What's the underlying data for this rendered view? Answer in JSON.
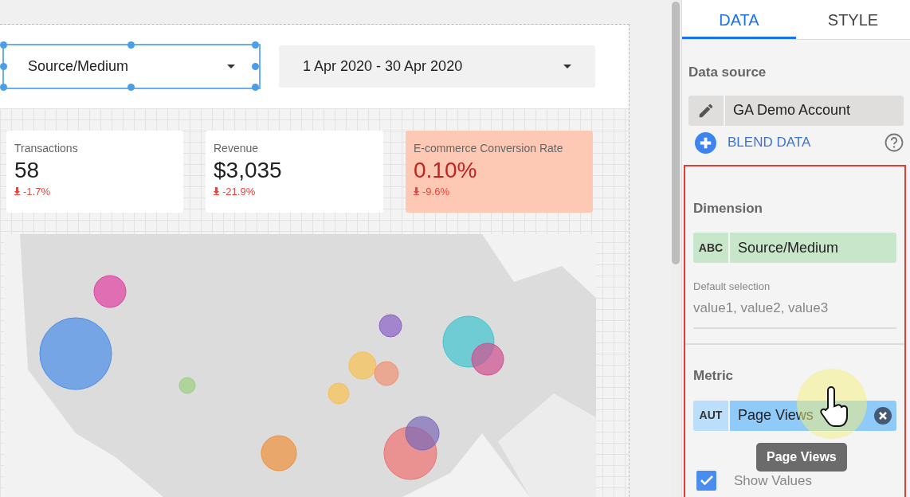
{
  "controls": [
    {
      "kind": "dropdown",
      "label": "Source/Medium",
      "selected": true
    },
    {
      "kind": "dropdown",
      "label": "1 Apr 2020 - 30 Apr 2020",
      "selected": false
    }
  ],
  "scorecards": [
    {
      "label": "Transactions",
      "value": "58",
      "change": "-1.7%",
      "highlighted": false
    },
    {
      "label": "Revenue",
      "value": "$3,035",
      "change": "-21.9%",
      "highlighted": false
    },
    {
      "label": "E-commerce Conversion Rate",
      "value": "0.10%",
      "change": "-9.6%",
      "highlighted": true
    }
  ],
  "panel": {
    "tabs": [
      {
        "label": "DATA",
        "selected": true
      },
      {
        "label": "STYLE",
        "selected": false
      }
    ],
    "data_source": {
      "heading": "Data source",
      "name": "GA Demo Account",
      "blend": "BLEND DATA"
    },
    "dimension": {
      "heading": "Dimension",
      "type": "ABC",
      "field": "Source/Medium",
      "default_label": "Default selection",
      "default_placeholder": "value1, value2, value3"
    },
    "metric": {
      "heading": "Metric",
      "type": "AUT",
      "field": "Page Views"
    },
    "show_values": {
      "label": "Show Values",
      "checked": true
    },
    "tooltip": "Page Views"
  }
}
